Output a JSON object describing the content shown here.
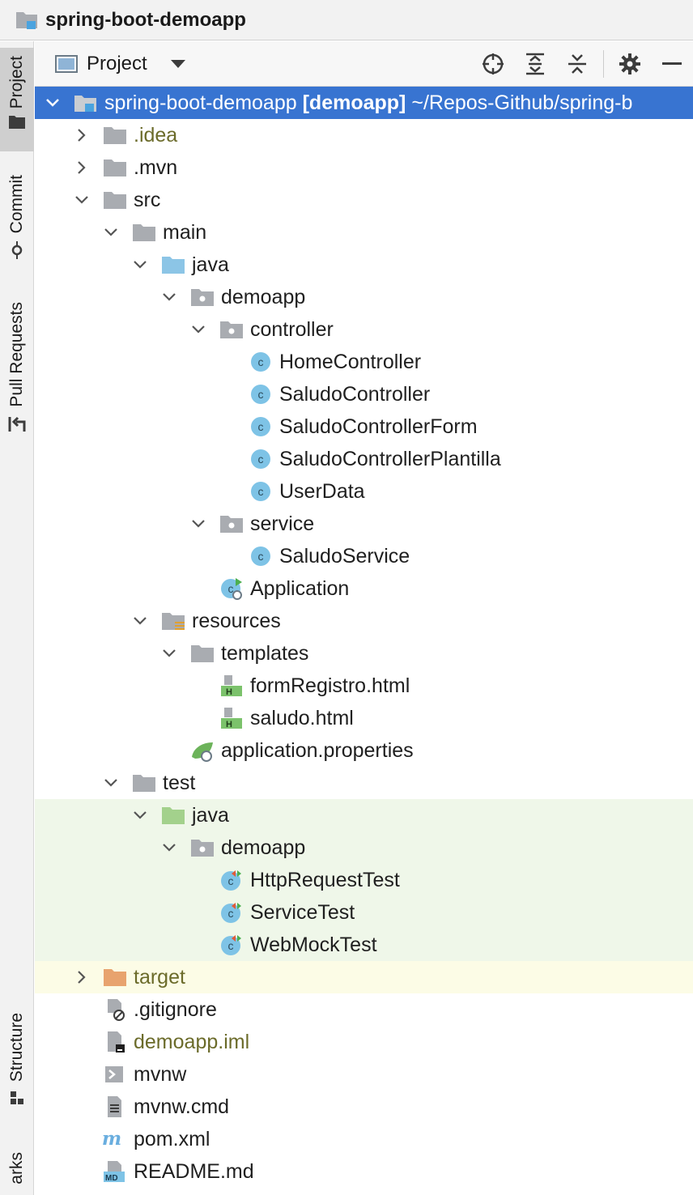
{
  "window": {
    "title": "spring-boot-demoapp"
  },
  "toolbar": {
    "view_label": "Project"
  },
  "stripe": {
    "project": "Project",
    "commit": "Commit",
    "pull_requests": "Pull Requests",
    "structure": "Structure",
    "bookmarks": "arks"
  },
  "tree": {
    "root": {
      "name": "spring-boot-demoapp",
      "module": "[demoapp]",
      "path": "~/Repos-Github/spring-b"
    },
    "idea": ".idea",
    "mvn": ".mvn",
    "src": "src",
    "main": "main",
    "main_java": "java",
    "main_demoapp": "demoapp",
    "controller": "controller",
    "home_controller": "HomeController",
    "saludo_controller": "SaludoController",
    "saludo_controller_form": "SaludoControllerForm",
    "saludo_controller_plantilla": "SaludoControllerPlantilla",
    "user_data": "UserData",
    "service": "service",
    "saludo_service": "SaludoService",
    "application": "Application",
    "resources": "resources",
    "templates": "templates",
    "form_registro": "formRegistro.html",
    "saludo_html": "saludo.html",
    "app_properties": "application.properties",
    "test": "test",
    "test_java": "java",
    "test_demoapp": "demoapp",
    "http_request_test": "HttpRequestTest",
    "service_test": "ServiceTest",
    "web_mock_test": "WebMockTest",
    "target": "target",
    "gitignore": ".gitignore",
    "demoapp_iml": "demoapp.iml",
    "mvnw": "mvnw",
    "mvnw_cmd": "mvnw.cmd",
    "pom": "pom.xml",
    "readme": "README.md"
  },
  "colors": {
    "selection": "#3874d1",
    "test_background": "#eff7e9",
    "excluded_background": "#fcfce6",
    "folder_gray": "#a9acb1",
    "folder_blue": "#8cc5e6",
    "folder_green": "#a3d18c",
    "folder_orange": "#e8a36e",
    "class_icon": "#7ec3e6",
    "ignored_text": "#6b6b2a"
  }
}
